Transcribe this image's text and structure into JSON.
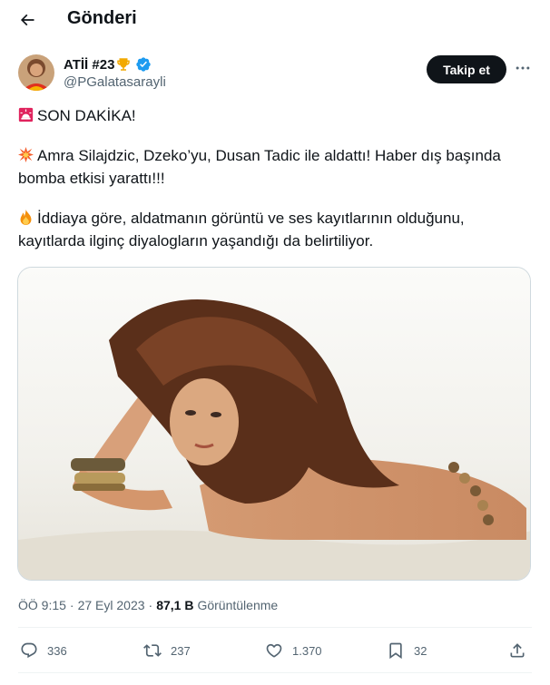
{
  "header": {
    "title": "Gönderi",
    "back_icon": "arrow-left-icon"
  },
  "author": {
    "name": "ATİİ #23",
    "handle": "@PGalatasarayli",
    "badges": [
      "trophy-icon",
      "verified-icon"
    ],
    "verified_color": "#1d9bf0"
  },
  "follow_button": {
    "label": "Takip et"
  },
  "more_button": {
    "icon": "more-horizontal-icon"
  },
  "tweet": {
    "paragraphs": [
      {
        "emoji": "rotating-light-icon",
        "text": "SON DAKİKA!"
      },
      {
        "emoji": "collision-icon",
        "text": "Amra Silajdzic, Dzeko’yu, Dusan Tadic ile aldattı! Haber dış başında bomba etkisi yarattı!!!"
      },
      {
        "emoji": "fire-icon",
        "text": "İddiaya göre, aldatmanın görüntü ve ses kayıtlarının olduğunu, kayıtlarda ilginç diyalogların yaşandığı da belirtiliyor."
      }
    ]
  },
  "meta": {
    "time": "ÖÖ 9:15",
    "separator": "·",
    "date": "27 Eyl 2023",
    "views_count": "87,1 B",
    "views_label": "Görüntülenme"
  },
  "actions": {
    "replies": "336",
    "retweets": "237",
    "likes": "1.370",
    "bookmarks": "32"
  },
  "colors": {
    "text_primary": "#0f1419",
    "text_secondary": "#536471",
    "border": "#eff3f4",
    "button_dark": "#0f1419"
  }
}
